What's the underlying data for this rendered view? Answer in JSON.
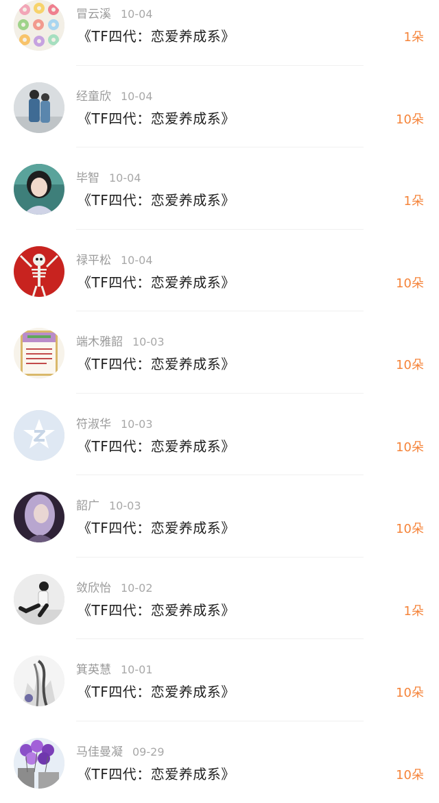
{
  "items": [
    {
      "name": "冒云溪",
      "date": "10-04",
      "title": "《TF四代：恋爱养成系》",
      "count": "1朵",
      "avatar": "donuts-avatar"
    },
    {
      "name": "经童欣",
      "date": "10-04",
      "title": "《TF四代：恋爱养成系》",
      "count": "10朵",
      "avatar": "denim-couple-avatar"
    },
    {
      "name": "毕智",
      "date": "10-04",
      "title": "《TF四代：恋爱养成系》",
      "count": "1朵",
      "avatar": "portrait-avatar"
    },
    {
      "name": "禄平松",
      "date": "10-04",
      "title": "《TF四代：恋爱养成系》",
      "count": "10朵",
      "avatar": "skeleton-avatar"
    },
    {
      "name": "端木雅韶",
      "date": "10-03",
      "title": "《TF四代：恋爱养成系》",
      "count": "10朵",
      "avatar": "poster-avatar"
    },
    {
      "name": "符淑华",
      "date": "10-03",
      "title": "《TF四代：恋爱养成系》",
      "count": "10朵",
      "avatar": "default-star-avatar"
    },
    {
      "name": "韶广",
      "date": "10-03",
      "title": "《TF四代：恋爱养成系》",
      "count": "10朵",
      "avatar": "purple-hair-avatar"
    },
    {
      "name": "敛欣怡",
      "date": "10-02",
      "title": "《TF四代：恋爱养成系》",
      "count": "1朵",
      "avatar": "sitting-person-avatar"
    },
    {
      "name": "箕英慧",
      "date": "10-01",
      "title": "《TF四代：恋爱养成系》",
      "count": "10朵",
      "avatar": "sketch-avatar"
    },
    {
      "name": "马佳曼凝",
      "date": "09-29",
      "title": "《TF四代：恋爱养成系》",
      "count": "10朵",
      "avatar": "balloons-avatar"
    }
  ],
  "colors": {
    "accent": "#f5843a",
    "name_text": "#9a9a9a",
    "title_text": "#1f1f1f"
  }
}
